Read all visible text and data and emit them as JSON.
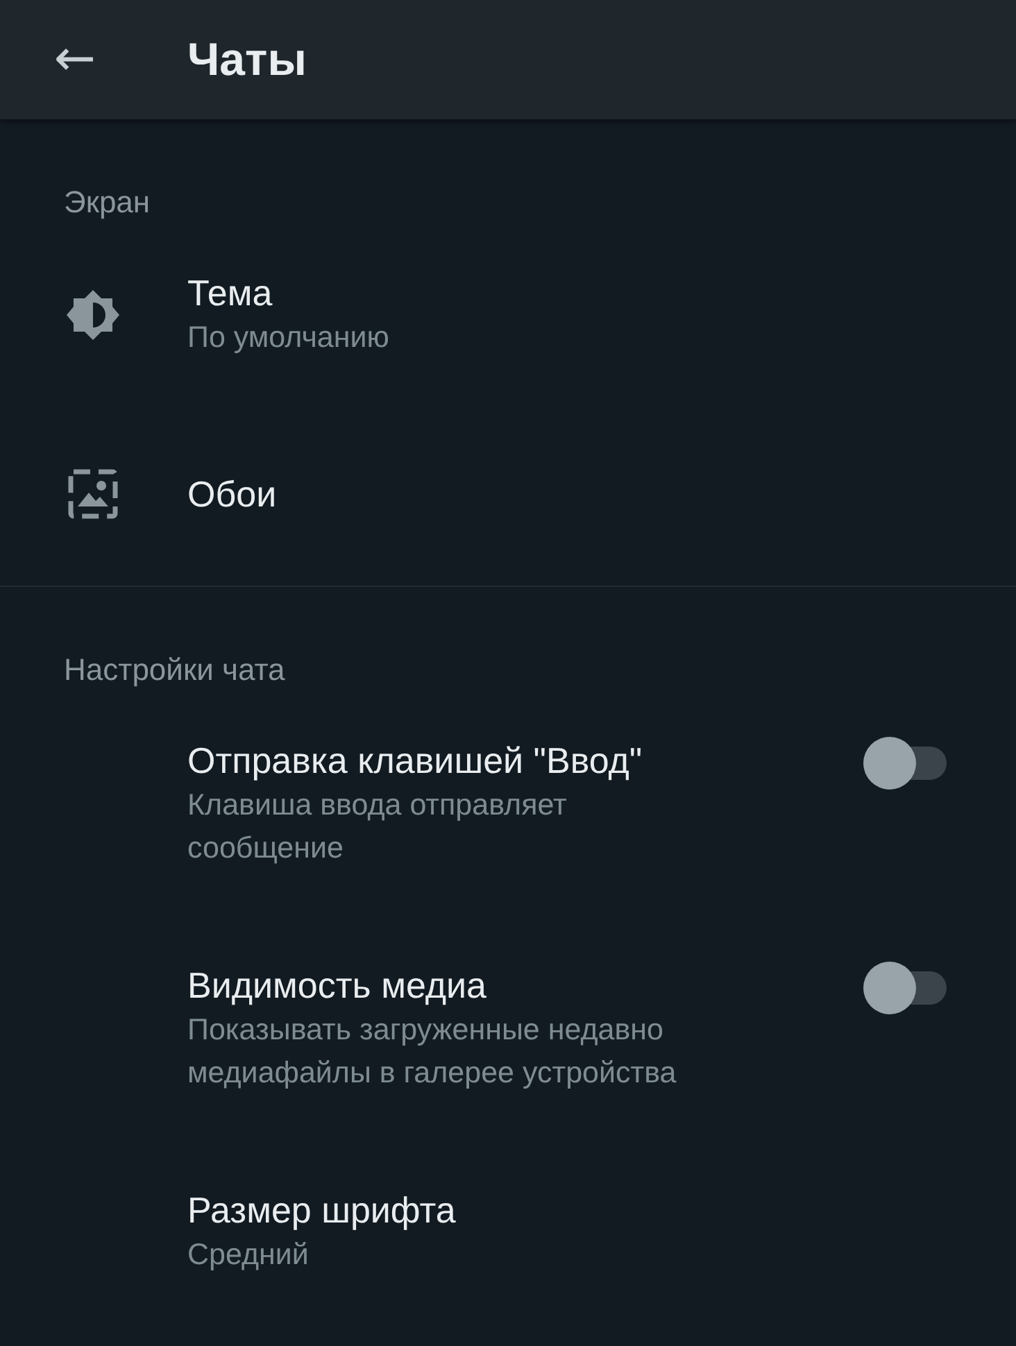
{
  "app_bar": {
    "back": "←",
    "title": "Чаты"
  },
  "sections": [
    {
      "header": "Экран",
      "items": [
        {
          "kind": "theme",
          "title": "Тема",
          "subtitle": "По умолчанию"
        },
        {
          "kind": "wallpaper",
          "title": "Обои"
        }
      ]
    },
    {
      "header": "Настройки чата",
      "items": [
        {
          "kind": "toggle",
          "title": "Отправка клавишей \"Ввод\"",
          "subtitle": "Клавиша ввода отправляет сообщение",
          "on": false
        },
        {
          "kind": "toggle",
          "title": "Видимость медиа",
          "subtitle": "Показывать загруженные недавно медиафайлы в галерее устройства",
          "on": false
        },
        {
          "kind": "plain",
          "title": "Размер шрифта",
          "subtitle": "Средний"
        }
      ]
    }
  ]
}
